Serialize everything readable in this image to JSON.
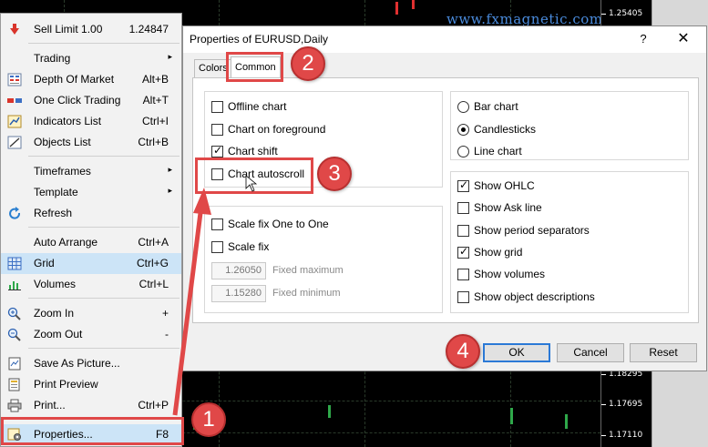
{
  "watermark": "www.fxmagnetic.com",
  "price_axis": [
    "1.25405",
    "1.18295",
    "1.17695",
    "1.17110"
  ],
  "context_menu": {
    "items": [
      {
        "label": "Sell Limit 1.00",
        "shortcut": "1.24847",
        "icon": "sell-limit-icon"
      },
      {
        "label": "Trading",
        "submenu": "▸"
      },
      {
        "label": "Depth Of Market",
        "shortcut": "Alt+B",
        "icon": "depth-of-market-icon"
      },
      {
        "label": "One Click Trading",
        "shortcut": "Alt+T",
        "icon": "one-click-trading-icon"
      },
      {
        "label": "Indicators List",
        "shortcut": "Ctrl+I",
        "icon": "indicators-list-icon"
      },
      {
        "label": "Objects List",
        "shortcut": "Ctrl+B",
        "icon": "objects-list-icon"
      },
      {
        "label": "Timeframes",
        "submenu": "▸"
      },
      {
        "label": "Template",
        "submenu": "▸"
      },
      {
        "label": "Refresh",
        "icon": "refresh-icon"
      },
      {
        "label": "Auto Arrange",
        "shortcut": "Ctrl+A"
      },
      {
        "label": "Grid",
        "shortcut": "Ctrl+G",
        "icon": "grid-icon"
      },
      {
        "label": "Volumes",
        "shortcut": "Ctrl+L",
        "icon": "volumes-icon"
      },
      {
        "label": "Zoom In",
        "shortcut": "+",
        "icon": "zoom-in-icon"
      },
      {
        "label": "Zoom Out",
        "shortcut": "-",
        "icon": "zoom-out-icon"
      },
      {
        "label": "Save As Picture...",
        "icon": "save-picture-icon"
      },
      {
        "label": "Print Preview",
        "icon": "print-preview-icon"
      },
      {
        "label": "Print...",
        "shortcut": "Ctrl+P",
        "icon": "print-icon"
      },
      {
        "label": "Properties...",
        "shortcut": "F8",
        "icon": "properties-icon"
      }
    ]
  },
  "dialog": {
    "title": "Properties of EURUSD,Daily",
    "help": "?",
    "close": "✕",
    "tabs": [
      "Colors",
      "Common"
    ],
    "left_checks": [
      {
        "label": "Offline chart",
        "checked": false
      },
      {
        "label": "Chart on foreground",
        "checked": false
      },
      {
        "label": "Chart shift",
        "checked": true
      },
      {
        "label": "Chart autoscroll",
        "checked": false
      }
    ],
    "scale_checks": [
      {
        "label": "Scale fix One to One",
        "checked": false
      },
      {
        "label": "Scale fix",
        "checked": false
      }
    ],
    "fixed_max": {
      "value": "1.26050",
      "label": "Fixed maximum"
    },
    "fixed_min": {
      "value": "1.15280",
      "label": "Fixed minimum"
    },
    "chart_types": [
      {
        "label": "Bar chart",
        "selected": false
      },
      {
        "label": "Candlesticks",
        "selected": true
      },
      {
        "label": "Line chart",
        "selected": false
      }
    ],
    "show_checks": [
      {
        "label": "Show OHLC",
        "checked": true
      },
      {
        "label": "Show Ask line",
        "checked": false
      },
      {
        "label": "Show period separators",
        "checked": false
      },
      {
        "label": "Show grid",
        "checked": true
      },
      {
        "label": "Show volumes",
        "checked": false
      },
      {
        "label": "Show object descriptions",
        "checked": false
      }
    ],
    "buttons": {
      "ok": "OK",
      "cancel": "Cancel",
      "reset": "Reset"
    }
  },
  "annotations": [
    "1",
    "2",
    "3",
    "4"
  ],
  "colors": {
    "accent": "#e04848",
    "watermark": "#4a8bdc",
    "ok_border": "#2b79d6"
  }
}
